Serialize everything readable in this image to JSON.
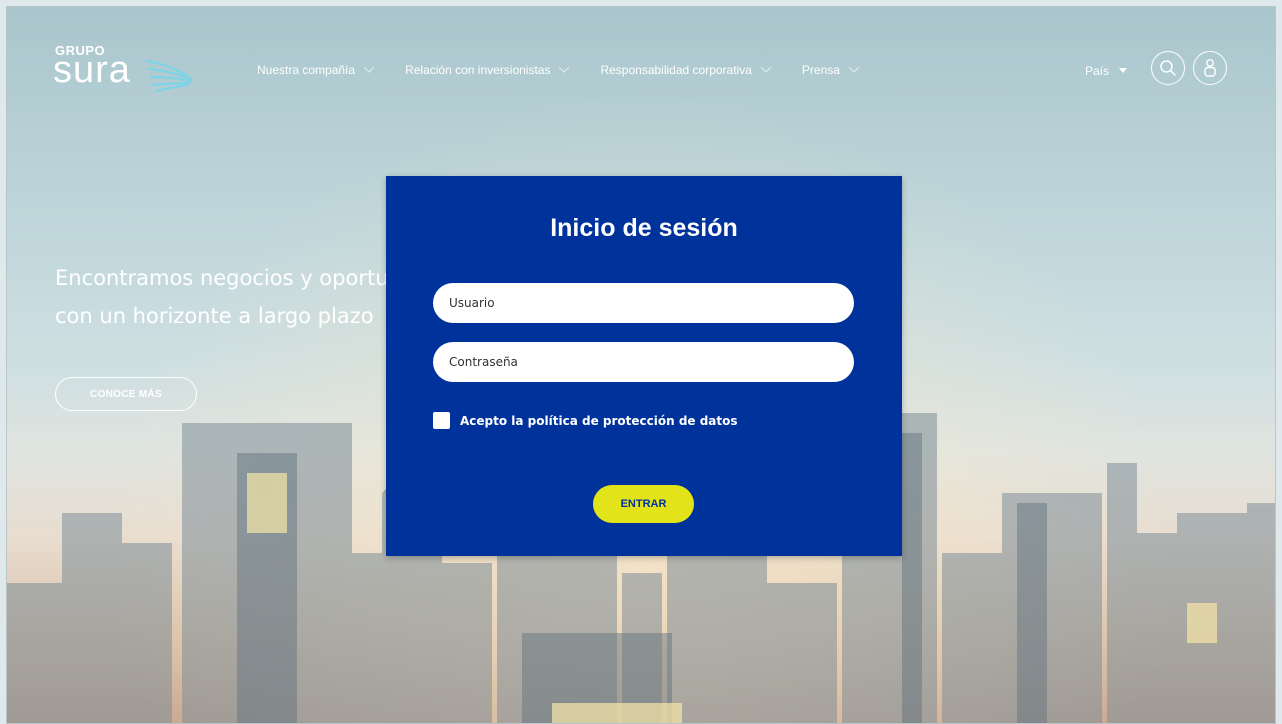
{
  "header": {
    "logo_small": "GRUPO",
    "logo_main": "sura",
    "nav": [
      {
        "label": "Nuestra compañía"
      },
      {
        "label": "Relación con inversionistas"
      },
      {
        "label": "Responsabilidad corporativa"
      },
      {
        "label": "Prensa"
      }
    ],
    "country_label": "País"
  },
  "hero": {
    "line1": "Encontramos negocios y oportu",
    "line2": "con un horizonte a largo plazo",
    "button": "CONOCE MÁS"
  },
  "login": {
    "title": "Inicio de sesión",
    "username_placeholder": "Usuario",
    "password_placeholder": "Contraseña",
    "username_value": "",
    "password_value": "",
    "checkbox_label": "Acepto la política de protección de datos",
    "checkbox_checked": false,
    "submit_label": "ENTRAR"
  },
  "colors": {
    "modal_bg": "#00329c",
    "submit_bg": "#e3e319",
    "text_light": "#ffffff"
  },
  "icons": [
    "chevron-down-icon",
    "caret-down-icon",
    "search-icon",
    "user-icon",
    "sura-wing-logo"
  ]
}
